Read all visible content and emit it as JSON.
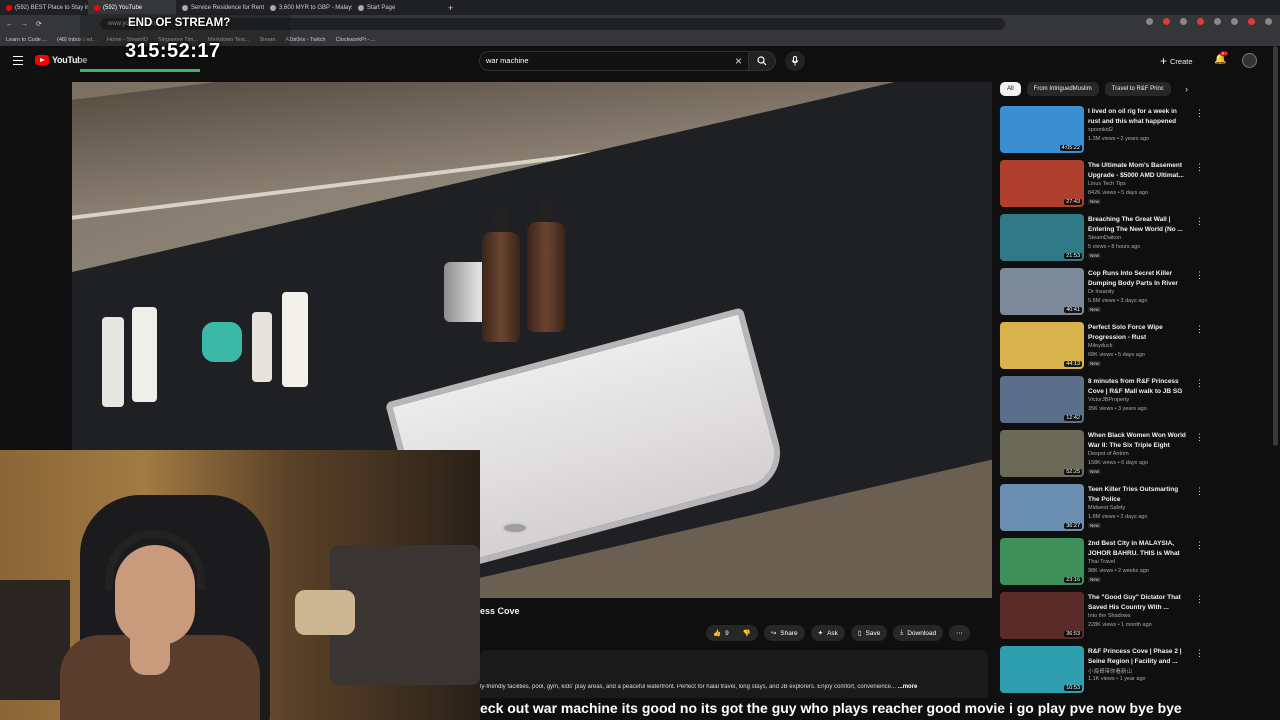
{
  "browser": {
    "tabs": [
      {
        "label": "(592) BEST Place to Stay in ...",
        "active": false
      },
      {
        "label": "(592) YouTube",
        "active": true
      },
      {
        "label": "Service Residence for Rent",
        "active": false
      },
      {
        "label": "3,600 MYR to GBP - Malays...",
        "active": false
      },
      {
        "label": "Start Page",
        "active": false
      }
    ],
    "address": "www.youtube.com",
    "bookmarks": [
      "Learn to Code ...",
      "(48) Inbox | ed...",
      "Home - SteamID",
      "Singapore Tim...",
      "Markdown Text...",
      "Steam",
      "A1bi0rix - Twitch",
      "ClockworkPi - ..."
    ]
  },
  "stream_overlay": {
    "label": "END OF STREAM?",
    "timer": "315:52:17"
  },
  "youtube": {
    "logo_text": "YouTube",
    "search_value": "war machine",
    "create_label": "Create",
    "notifications_badge": "9+",
    "video": {
      "title_visible": "ess Cove",
      "likes": "9",
      "share": "Share",
      "ask": "Ask",
      "save": "Save",
      "download": "Download",
      "description": "ly-friendly facilities, pool, gym, kids' play areas, and a peaceful waterfront. Perfect for halal travel, long stays, and JB explorers. Enjoy comfort, convenience...",
      "more": "...more"
    },
    "chips": [
      "All",
      "From IntriguedMuslim",
      "Travel to R&F Princ"
    ],
    "recommendations": [
      {
        "title": "I lived on oil rig for a week in rust and this what happened",
        "channel": "spoonkid2",
        "meta": "1.3M views • 2 years ago",
        "duration": "4:05:22",
        "new": false,
        "thumb": "#3a8fd0"
      },
      {
        "title": "The Ultimate Mom's Basement Upgrade - $5000 AMD Ultimat...",
        "channel": "Linus Tech Tips",
        "meta": "842K views • 5 days ago",
        "duration": "27:43",
        "new": true,
        "thumb": "#b0402e"
      },
      {
        "title": "Breaching The Great Wall | Entering The New World (No ...",
        "channel": "SteamDaikon",
        "meta": "5 views • 8 hours ago",
        "duration": "21:53",
        "new": true,
        "thumb": "#2f7a86"
      },
      {
        "title": "Cop Runs Into Secret Killer Dumping Body Parts In River",
        "channel": "Dr Insanity",
        "meta": "5.8M views • 3 days ago",
        "duration": "40:41",
        "new": true,
        "thumb": "#7c8a9a"
      },
      {
        "title": "Perfect Solo Force Wipe Progression - Rust",
        "channel": "Mileyduck",
        "meta": "68K views • 5 days ago",
        "duration": "44:13",
        "new": true,
        "thumb": "#d8b24a"
      },
      {
        "title": "8 minutes from R&F Princess Cove | R&F Mall walk to JB SG ...",
        "channel": "VictorJBProperty",
        "meta": "35K views • 3 years ago",
        "duration": "12:42",
        "new": false,
        "thumb": "#5b6f8a"
      },
      {
        "title": "When Black Women Won World War II: The Six Triple Eight",
        "channel": "Despot of Antrim",
        "meta": "158K views • 6 days ago",
        "duration": "52:25",
        "new": true,
        "thumb": "#6b6a58"
      },
      {
        "title": "Teen Killer Tries Outsmarting The Police",
        "channel": "Midwest Safety",
        "meta": "1.8M views • 2 days ago",
        "duration": "36:27",
        "new": true,
        "thumb": "#6b8fb0"
      },
      {
        "title": "2nd Best City in MALAYSIA, JOHOR BAHRU. THIS is What I...",
        "channel": "Thai Travel",
        "meta": "98K views • 2 weeks ago",
        "duration": "23:16",
        "new": true,
        "thumb": "#3f8f5a"
      },
      {
        "title": "The \"Good Guy\" Dictator That Saved His Country With ...",
        "channel": "Into the Shadows",
        "meta": "228K views • 1 month ago",
        "duration": "36:53",
        "new": false,
        "thumb": "#5a2b28"
      },
      {
        "title": "R&F Princess Cove | Phase 2 | Seine Region | Facility and ...",
        "channel": "小海哥带你看新山",
        "meta": "1.1K views • 1 year ago",
        "duration": "10:53",
        "new": false,
        "thumb": "#2f9fb0"
      }
    ]
  },
  "ticker_text": "eck out war machine its good no its got the guy who plays reacher good movie i go play pve now bye bye"
}
